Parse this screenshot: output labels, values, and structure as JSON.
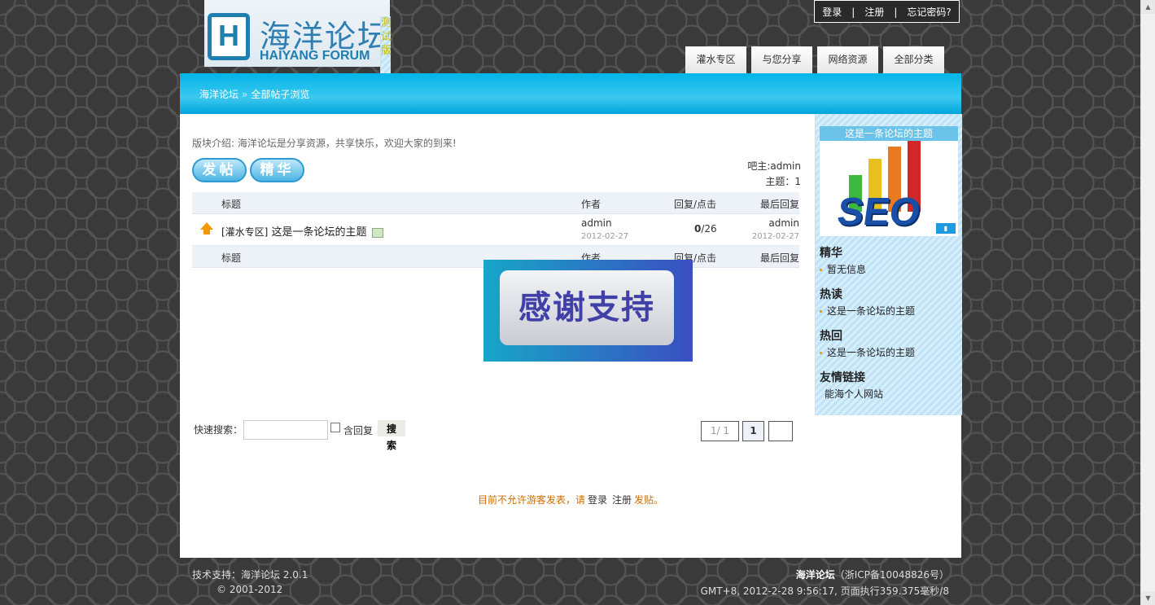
{
  "header": {
    "logo": {
      "cn": "海洋论坛",
      "en": "HAIYANG FORUM",
      "side_text": "测试版"
    },
    "top_links": [
      "登录",
      "注册",
      "忘记密码?"
    ],
    "top_sep": "|",
    "tabs": [
      "灌水专区",
      "与您分享",
      "网络资源",
      "全部分类"
    ]
  },
  "breadcrumb": {
    "home": "海洋论坛",
    "sep": "»",
    "current": "全部帖子浏览"
  },
  "main": {
    "intro": "版块介绍: 海洋论坛是分享资源，共享快乐，欢迎大家的到来!",
    "post_button": "发帖",
    "digest_button": "精华",
    "owner": "吧主:admin",
    "topic_count": "主题：1",
    "columns": {
      "title": "标题",
      "author": "作者",
      "replies": "回复/点击",
      "last": "最后回复"
    },
    "threads": [
      {
        "category": "[灌水专区]",
        "title": "这是一条论坛的主题",
        "author": "admin",
        "date": "2012-02-27",
        "replies": "0",
        "clicks": "/26",
        "last_author": "admin",
        "last_date": "2012-02-27"
      }
    ],
    "thanks_image_text": "感谢支持",
    "quick_search": {
      "label": "快速搜索：",
      "value": "",
      "include_replies": "含回复",
      "button": "搜索"
    },
    "pager": {
      "summary": "1/ 1",
      "current": "1",
      "next": ""
    },
    "notice": {
      "prefix": "目前不允许游客发表，请",
      "login": "登录",
      "register": "注册",
      "suffix": "发贴。"
    }
  },
  "sidebar": {
    "featured_title": "这是一条论坛的主题",
    "seo_text": "SEO",
    "sections": [
      {
        "title": "精华",
        "items": [
          "暂无信息"
        ]
      },
      {
        "title": "热读",
        "items": [
          "这是一条论坛的主题"
        ]
      },
      {
        "title": "热回",
        "items": [
          "这是一条论坛的主题"
        ]
      },
      {
        "title": "友情链接",
        "items": [
          "能海个人网站"
        ]
      }
    ]
  },
  "footer": {
    "support": "技术支持：海洋论坛  2.0.1",
    "copyright": "© 2001-2012",
    "site_name": "海洋论坛",
    "icp": "（浙ICP备10048826号）",
    "timing": "GMT+8, 2012-2-28 9:56:17, 页面执行359.375毫秒/8"
  },
  "colors": {
    "banner": "#00b4e8",
    "notice": "#d06c00",
    "accent": "#2f9ad0"
  }
}
